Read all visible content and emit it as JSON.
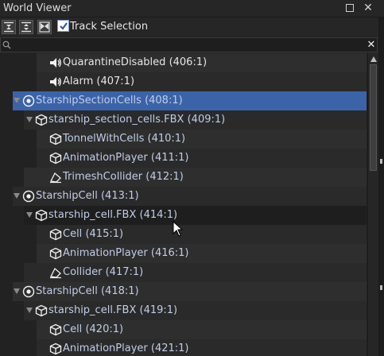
{
  "window": {
    "title": "World Viewer",
    "maximize_icon": "maximize-icon",
    "close_glyph": "✕"
  },
  "toolbar": {
    "buttons": [
      "collapse-all-icon",
      "expand-all-icon",
      "locate-icon"
    ],
    "track_selection": {
      "label": "Track Selection",
      "checked": true
    }
  },
  "search": {
    "value": "",
    "placeholder": "",
    "clear_glyph": "✕"
  },
  "colors": {
    "selected_row": "#3b63a8",
    "alt_row": "#2e2e2e",
    "base_row": "#2a2a2a",
    "dark_row": "#1e1e1e",
    "item_name": "#e6e6e6",
    "link_name": "#c0cde8"
  },
  "tree": [
    {
      "name": "QuarantineDisabled",
      "id": "(406:1)",
      "icon": "sound-icon",
      "depth": 2,
      "expandable": false,
      "selected": false
    },
    {
      "name": "Alarm",
      "id": "(407:1)",
      "icon": "sound-icon",
      "depth": 2,
      "expandable": false,
      "selected": false
    },
    {
      "name": "StarshipSectionCells",
      "id": "(408:1)",
      "icon": "pivot-icon",
      "depth": 0,
      "expandable": true,
      "selected": true
    },
    {
      "name": "starship_section_cells.FBX",
      "id": "(409:1)",
      "icon": "cube-icon",
      "depth": 1,
      "expandable": true,
      "selected": false
    },
    {
      "name": "TonnelWithCells",
      "id": "(410:1)",
      "icon": "cube-icon",
      "depth": 2,
      "expandable": false,
      "selected": false
    },
    {
      "name": "AnimationPlayer",
      "id": "(411:1)",
      "icon": "cube-icon",
      "depth": 2,
      "expandable": false,
      "selected": false
    },
    {
      "name": "TrimeshCollider",
      "id": "(412:1)",
      "icon": "collider-icon",
      "depth": 1,
      "expandable": false,
      "selected": false
    },
    {
      "name": "StarshipCell",
      "id": "(413:1)",
      "icon": "pivot-icon",
      "depth": 0,
      "expandable": true,
      "selected": false
    },
    {
      "name": "starship_cell.FBX",
      "id": "(414:1)",
      "icon": "cube-icon",
      "depth": 1,
      "expandable": true,
      "selected": false
    },
    {
      "name": "Cell",
      "id": "(415:1)",
      "icon": "cube-icon",
      "depth": 2,
      "expandable": false,
      "selected": false
    },
    {
      "name": "AnimationPlayer",
      "id": "(416:1)",
      "icon": "cube-icon",
      "depth": 2,
      "expandable": false,
      "selected": false
    },
    {
      "name": "Collider",
      "id": "(417:1)",
      "icon": "collider-icon",
      "depth": 1,
      "expandable": false,
      "selected": false
    },
    {
      "name": "StarshipCell",
      "id": "(418:1)",
      "icon": "pivot-icon",
      "depth": 0,
      "expandable": true,
      "selected": false
    },
    {
      "name": "starship_cell.FBX",
      "id": "(419:1)",
      "icon": "cube-icon",
      "depth": 1,
      "expandable": true,
      "selected": false
    },
    {
      "name": "Cell",
      "id": "(420:1)",
      "icon": "cube-icon",
      "depth": 2,
      "expandable": false,
      "selected": false
    },
    {
      "name": "AnimationPlayer",
      "id": "(421:1)",
      "icon": "cube-icon",
      "depth": 2,
      "expandable": false,
      "selected": false
    }
  ]
}
